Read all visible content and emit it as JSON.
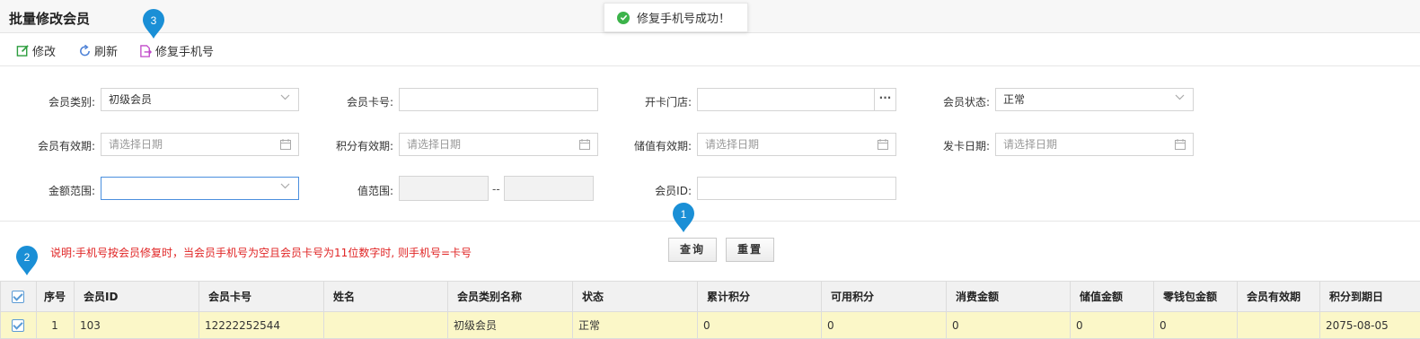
{
  "header": {
    "title": "批量修改会员"
  },
  "toast": {
    "message": "修复手机号成功！"
  },
  "toolbar": {
    "edit_label": "修改",
    "refresh_label": "刷新",
    "fix_phone_label": "修复手机号"
  },
  "form": {
    "member_type": {
      "label": "会员类别:",
      "value": "初级会员"
    },
    "card_no": {
      "label": "会员卡号:",
      "value": ""
    },
    "store": {
      "label": "开卡门店:",
      "value": "",
      "button": "···"
    },
    "status": {
      "label": "会员状态:",
      "value": "正常"
    },
    "member_expiry": {
      "label": "会员有效期:",
      "placeholder": "请选择日期"
    },
    "points_expiry": {
      "label": "积分有效期:",
      "placeholder": "请选择日期"
    },
    "stored_expiry": {
      "label": "储值有效期:",
      "placeholder": "请选择日期"
    },
    "issue_date": {
      "label": "发卡日期:",
      "placeholder": "请选择日期"
    },
    "amount_range": {
      "label": "金额范围:",
      "value": ""
    },
    "value_range": {
      "label": "值范围:",
      "separator": "--"
    },
    "member_id": {
      "label": "会员ID:",
      "value": ""
    }
  },
  "note": "说明:手机号按会员修复时，当会员手机号为空且会员卡号为11位数字时, 则手机号=卡号",
  "buttons": {
    "query": "查询",
    "reset": "重置"
  },
  "markers": {
    "m1": "1",
    "m2": "2",
    "m3": "3"
  },
  "table": {
    "columns": [
      "序号",
      "会员ID",
      "会员卡号",
      "姓名",
      "会员类别名称",
      "状态",
      "累计积分",
      "可用积分",
      "消费金额",
      "储值金额",
      "零钱包金额",
      "会员有效期",
      "积分到期日"
    ],
    "rows": [
      [
        "1",
        "103",
        "12222252544",
        "",
        "初级会员",
        "正常",
        "0",
        "0",
        "0",
        "0",
        "0",
        "",
        "2075-08-05"
      ]
    ]
  },
  "colors": {
    "accent": "#1a8fd6",
    "toast_ok": "#3cb34a",
    "note": "#e02424",
    "row_highlight": "#fbf7c8"
  }
}
